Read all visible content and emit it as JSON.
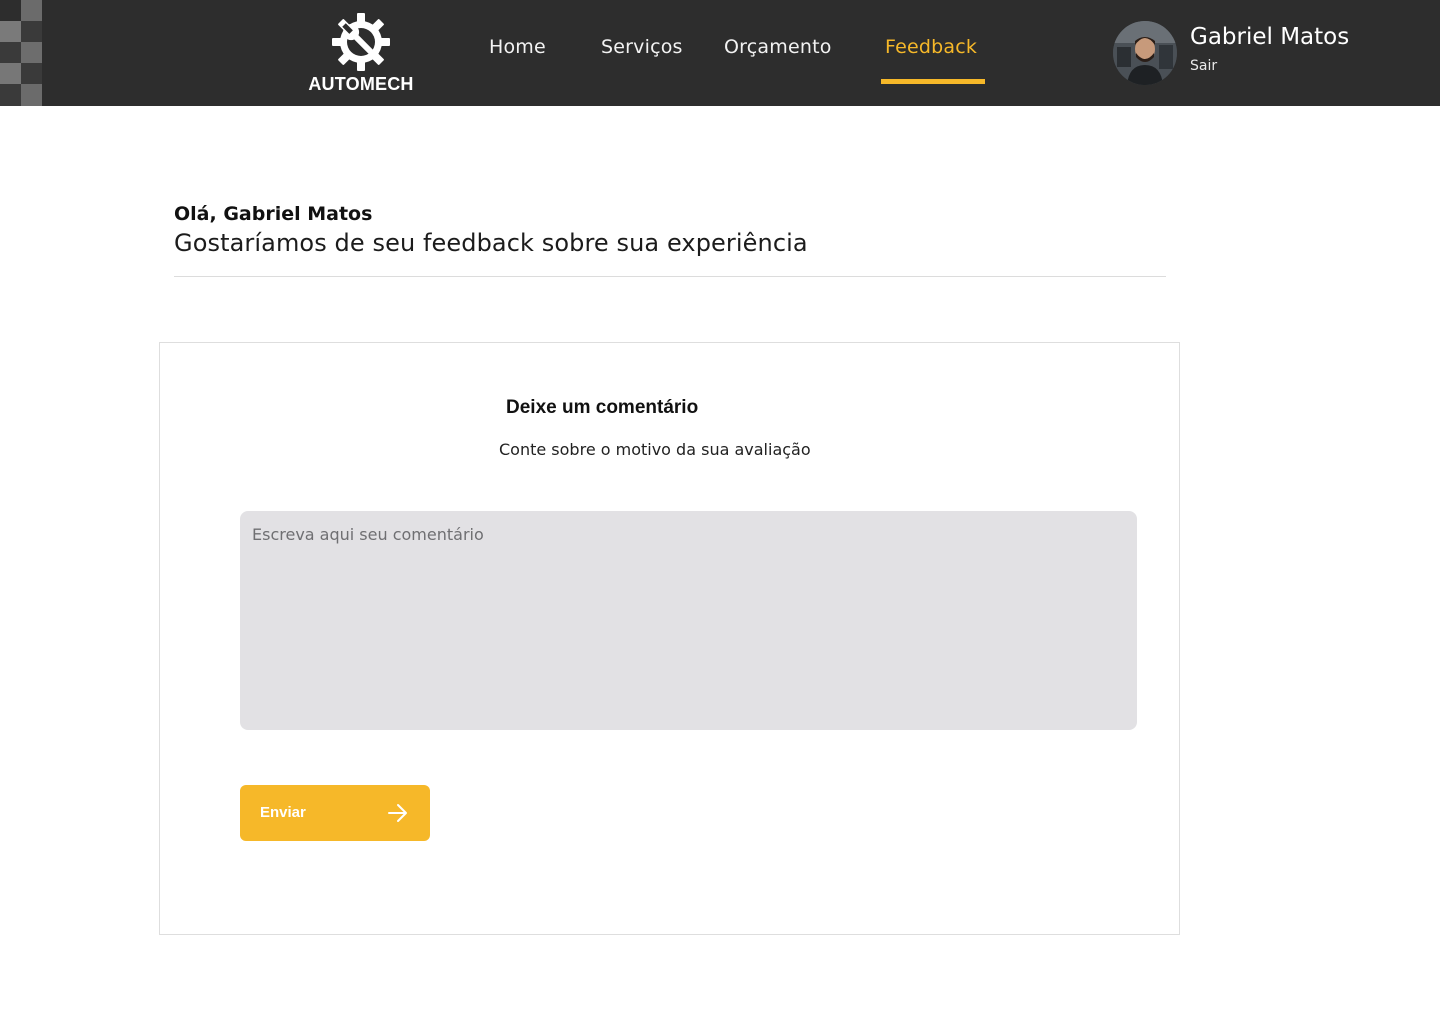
{
  "brand": {
    "name": "AUTOMECH",
    "logo_icon": "gear-wrench-icon"
  },
  "nav": {
    "items": [
      {
        "label": "Home",
        "active": false
      },
      {
        "label": "Serviços",
        "active": false
      },
      {
        "label": "Orçamento",
        "active": false
      },
      {
        "label": "Feedback",
        "active": true
      }
    ]
  },
  "user": {
    "name": "Gabriel Matos",
    "logout_label": "Sair",
    "avatar_icon": "user-avatar"
  },
  "greeting": {
    "hello": "Olá, Gabriel Matos",
    "subtitle": "Gostaríamos de seu feedback sobre sua experiência"
  },
  "feedback_form": {
    "title": "Deixe um comentário",
    "subtitle": "Conte sobre o motivo da sua avaliação",
    "comment_placeholder": "Escreva aqui seu comentário",
    "comment_value": "",
    "submit_label": "Enviar",
    "submit_icon": "arrow-right-icon"
  },
  "colors": {
    "header_bg": "#2d2d2d",
    "accent": "#f6b829",
    "textarea_bg": "#e2e1e4"
  }
}
